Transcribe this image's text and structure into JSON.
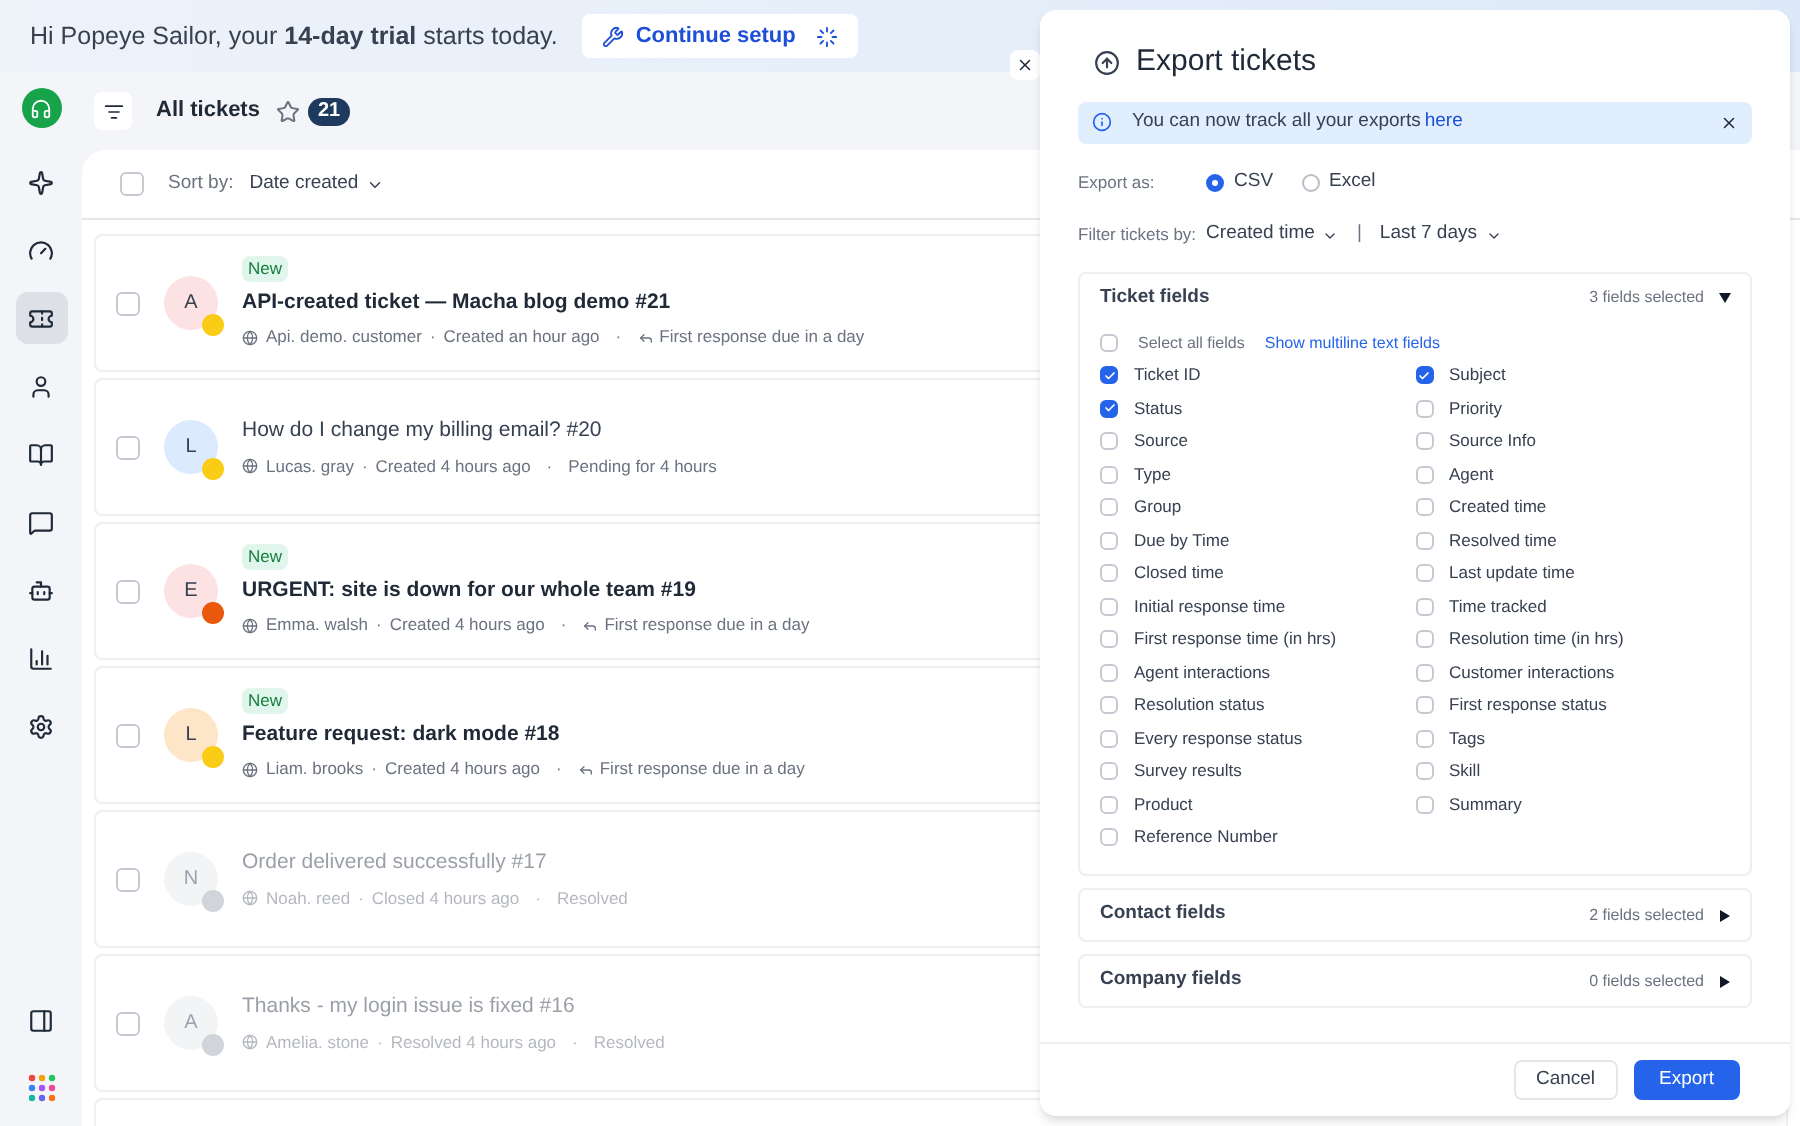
{
  "banner": {
    "text": "Hi Popeye Sailor, your **14-day trial** starts today.",
    "button": "Continue setup"
  },
  "sidebar": {
    "items": [
      {
        "kind": "spark",
        "selected": false
      },
      {
        "kind": "gauge",
        "selected": false
      },
      {
        "kind": "ticket",
        "selected": true
      },
      {
        "kind": "contact",
        "selected": false
      },
      {
        "kind": "book",
        "selected": false
      },
      {
        "kind": "chat",
        "selected": false
      },
      {
        "kind": "bot",
        "selected": false
      },
      {
        "kind": "chart",
        "selected": false
      },
      {
        "kind": "settings",
        "selected": false
      }
    ],
    "bottom": [
      {
        "kind": "panel"
      },
      {
        "kind": "apps"
      }
    ]
  },
  "header": {
    "title": "All tickets",
    "count": "21",
    "starred": false
  },
  "sort": {
    "label": "Sort by:",
    "value": "Date created",
    "checked": false
  },
  "tickets": [
    {
      "checked": false,
      "tag": "New",
      "initial": "A",
      "color": "#fde2e4",
      "mood": {
        "color": "#facc15"
      },
      "title": "API-created ticket — Macha blog demo #21",
      "customer": "Api. demo. customer",
      "created_separator": "·",
      "created": "Created an hour ago",
      "separator": "·",
      "status": "First response due in a day",
      "reply_icon": true,
      "resolved": false,
      "unread": true
    },
    {
      "checked": false,
      "initial": "L",
      "color": "#dbeafe",
      "mood": {
        "color": "#facc15"
      },
      "title": "How do I change my billing email? #20",
      "customer": "Lucas. gray",
      "created_separator": "·",
      "created": "Created 4 hours ago",
      "separator": "·",
      "status": "Pending for 4 hours",
      "reply_icon": false,
      "resolved": false,
      "unread": false
    },
    {
      "checked": false,
      "tag": "New",
      "initial": "E",
      "color": "#fde2e4",
      "mood": {
        "color": "#ea580c"
      },
      "title": "URGENT: site is down for our whole team #19",
      "customer": "Emma. walsh",
      "created_separator": "·",
      "created": "Created 4 hours ago",
      "separator": "·",
      "status": "First response due in a day",
      "reply_icon": true,
      "resolved": false,
      "unread": true
    },
    {
      "checked": false,
      "tag": "New",
      "initial": "L",
      "color": "#fde5c8",
      "mood": {
        "color": "#facc15"
      },
      "title": "Feature request: dark mode #18",
      "customer": "Liam. brooks",
      "created_separator": "·",
      "created": "Created 4 hours ago",
      "separator": "·",
      "status": "First response due in a day",
      "reply_icon": true,
      "resolved": false,
      "unread": true
    },
    {
      "checked": false,
      "initial": "N",
      "color": "#f3f4f6",
      "mood": {
        "color": "#d1d5db"
      },
      "title": "Order delivered successfully #17",
      "customer": "Noah. reed",
      "created_separator": "·",
      "created": "Closed 4 hours ago",
      "separator": "·",
      "status": "Resolved",
      "reply_icon": false,
      "resolved": true,
      "unread": false
    },
    {
      "checked": false,
      "initial": "A",
      "color": "#f3f4f6",
      "mood": {
        "color": "#d1d5db"
      },
      "title": "Thanks - my login issue is fixed #16",
      "customer": "Amelia. stone",
      "created_separator": "·",
      "created": "Resolved 4 hours ago",
      "separator": "·",
      "status": "Resolved",
      "reply_icon": false,
      "resolved": true,
      "unread": false
    }
  ],
  "export": {
    "title": "Export tickets",
    "notice": "You can now track all your exports",
    "notice_link": "here",
    "format_label": "Export as:",
    "formats": [
      {
        "label": "CSV",
        "selected": true
      },
      {
        "label": "Excel",
        "selected": false
      }
    ],
    "filter_label": "Filter tickets by:",
    "filter_field": "Created time",
    "filter_separator": "|",
    "filter_range": "Last 7 days",
    "sections": [
      {
        "title": "Ticket fields",
        "summary": "3 fields selected",
        "expanded": true,
        "select_all": "Select all fields",
        "select_all_checked": false,
        "multiline_link": "Show multiline text fields",
        "fields": [
          {
            "label": "Ticket ID",
            "checked": true
          },
          {
            "label": "Subject",
            "checked": true
          },
          {
            "label": "Status",
            "checked": true
          },
          {
            "label": "Priority",
            "checked": false
          },
          {
            "label": "Source",
            "checked": false
          },
          {
            "label": "Source Info",
            "checked": false
          },
          {
            "label": "Type",
            "checked": false
          },
          {
            "label": "Agent",
            "checked": false
          },
          {
            "label": "Group",
            "checked": false
          },
          {
            "label": "Created time",
            "checked": false
          },
          {
            "label": "Due by Time",
            "checked": false
          },
          {
            "label": "Resolved time",
            "checked": false
          },
          {
            "label": "Closed time",
            "checked": false
          },
          {
            "label": "Last update time",
            "checked": false
          },
          {
            "label": "Initial response time",
            "checked": false
          },
          {
            "label": "Time tracked",
            "checked": false
          },
          {
            "label": "First response time (in hrs)",
            "checked": false
          },
          {
            "label": "Resolution time (in hrs)",
            "checked": false
          },
          {
            "label": "Agent interactions",
            "checked": false
          },
          {
            "label": "Customer interactions",
            "checked": false
          },
          {
            "label": "Resolution status",
            "checked": false
          },
          {
            "label": "First response status",
            "checked": false
          },
          {
            "label": "Every response status",
            "checked": false
          },
          {
            "label": "Tags",
            "checked": false
          },
          {
            "label": "Survey results",
            "checked": false
          },
          {
            "label": "Skill",
            "checked": false
          },
          {
            "label": "Product",
            "checked": false
          },
          {
            "label": "Summary",
            "checked": false
          },
          {
            "label": "Reference Number",
            "checked": false
          }
        ]
      },
      {
        "title": "Contact fields",
        "summary": "2 fields selected",
        "expanded": false
      },
      {
        "title": "Company fields",
        "summary": "0 fields selected",
        "expanded": false
      }
    ],
    "cancel": "Cancel",
    "confirm": "Export"
  }
}
